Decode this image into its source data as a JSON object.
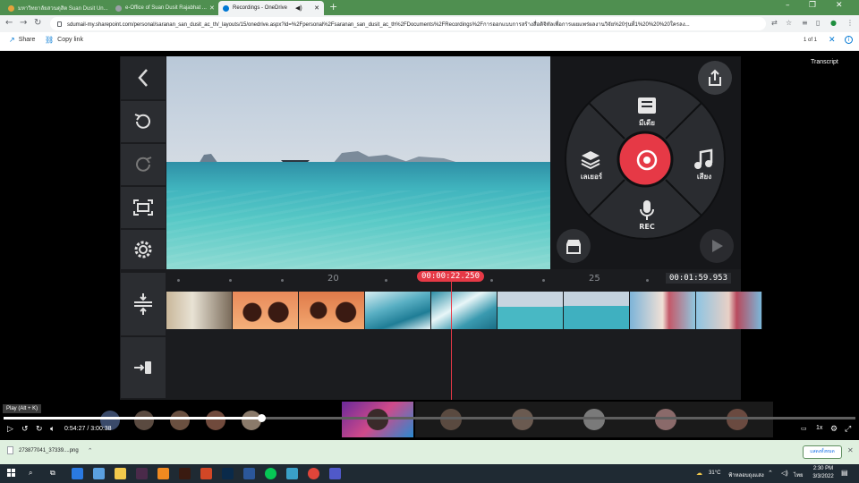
{
  "browser": {
    "tabs": [
      {
        "title": "มหาวิทยาลัยสวนดุสิต Suan Dusit Un...",
        "active": false,
        "favicon_color": "#e6a23c"
      },
      {
        "title": "e-Office of Suan Dusit Rajabhat ...",
        "active": false,
        "favicon_color": "#9aa0a6"
      },
      {
        "title": "Recordings - OneDrive",
        "active": true,
        "favicon_color": "#0078d4"
      }
    ],
    "new_tab_glyph": "+",
    "url": "sdumail-my.sharepoint.com/personal/saranan_san_dusit_ac_th/_layouts/15/onedrive.aspx?id=%2Fpersonal%2Fsaranan_san_dusit_ac_th%2FDocuments%2FRecordings%2Fการออกแบบการสร้างสื่อดิจิทัลเพื่อการเผยแพร่ผลงานวิจัย%20รุ่นที่1%20%20%20ใครลง..."
  },
  "commandbar": {
    "share_label": "Share",
    "copy_link_label": "Copy link",
    "pager": "1 of 1"
  },
  "video": {
    "transcript_label": "Transcript"
  },
  "app": {
    "wheel": {
      "media_label": "มีเดีย",
      "layer_label": "เลเยอร์",
      "audio_label": "เสียง",
      "rec_label": "REC"
    },
    "timeline": {
      "tick_20": "20",
      "tick_25": "25",
      "current_time": "00:00:22.250",
      "total_time": "00:01:59.953"
    }
  },
  "player": {
    "tooltip": "Play (Alt + K)",
    "current": "0:54:27",
    "separator": "/",
    "duration": "3:00:38",
    "progress": 0.302,
    "speed": "1x"
  },
  "download": {
    "filename": "273877041_37339....png",
    "show_all": "แสดงทั้งหมด"
  },
  "taskbar": {
    "temperature": "31°C",
    "weather_text": "ฟ้าหลอบถุงแสง",
    "language": "ไทย",
    "time": "2:30 PM",
    "date": "3/3/2022"
  }
}
